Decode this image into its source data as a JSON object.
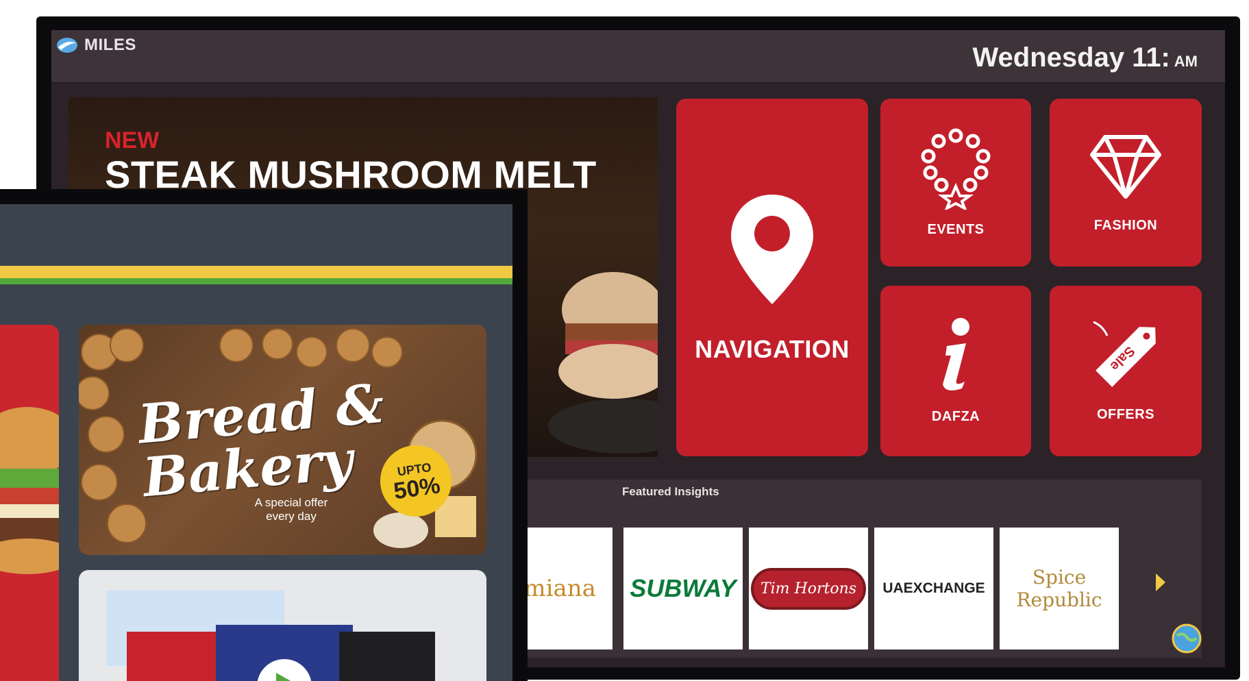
{
  "kiosk": {
    "brand": "MILES",
    "clock": {
      "day_time": "Wednesday 11:",
      "ampm": "AM"
    },
    "promo": {
      "badge": "NEW",
      "title": "STEAK MUSHROOM MELT"
    },
    "tiles": [
      {
        "label": "NAVIGATION",
        "icon": "location-pin-icon"
      },
      {
        "label": "EVENTS",
        "icon": "necklace-icon"
      },
      {
        "label": "FASHION",
        "icon": "diamond-icon"
      },
      {
        "label": "DAFZA",
        "icon": "info-icon"
      },
      {
        "label": "OFFERS",
        "icon": "sale-tag-icon"
      }
    ],
    "featured": {
      "title": "Featured Insights",
      "brands": [
        "amiana",
        "SUBWAY",
        "Tim Hortons",
        "UAEXCHANGE",
        "Spice Republic"
      ]
    },
    "colors": {
      "tile": "#c21f2b",
      "background": "#2b2327",
      "topbar": "#3d3338"
    }
  },
  "tablet": {
    "bakery": {
      "title_line1": "Bread &",
      "title_line2": "Bakery",
      "badge_line1": "UPTO",
      "badge_line2": "50%",
      "subtitle": "A special offer every day"
    },
    "colors": {
      "stripe_yellow": "#f2c945",
      "stripe_green": "#53a83a",
      "screen": "#3b444e"
    }
  }
}
